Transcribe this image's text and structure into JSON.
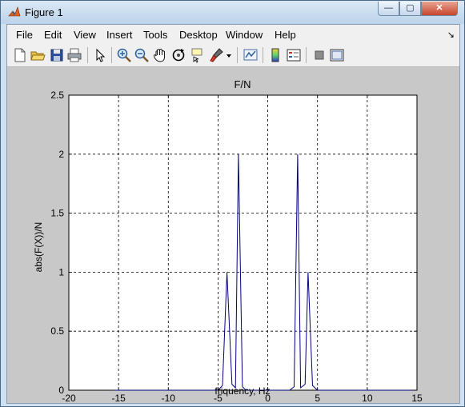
{
  "window": {
    "title": "Figure 1",
    "min_symbol": "—",
    "max_symbol": "▢",
    "close_symbol": "✕"
  },
  "menu": [
    "File",
    "Edit",
    "View",
    "Insert",
    "Tools",
    "Desktop",
    "Window",
    "Help"
  ],
  "toolbar_icons": [
    "new-figure-icon",
    "open-file-icon",
    "save-icon",
    "print-icon",
    "select-arrow-icon",
    "zoom-in-icon",
    "zoom-out-icon",
    "pan-hand-icon",
    "rotate-3d-icon",
    "data-cursor-icon",
    "brush-icon",
    "brush-dropdown-icon",
    "link-plot-icon",
    "colorbar-icon",
    "legend-icon",
    "hide-plot-tools-icon",
    "show-plot-tools-icon"
  ],
  "chart_data": {
    "type": "line",
    "title": "F/N",
    "xlabel": "friquency, Hz",
    "ylabel": "abs(F(X))/N",
    "xlim": [
      -20,
      15
    ],
    "ylim": [
      0,
      2.5
    ],
    "xticks": [
      -20,
      -15,
      -10,
      -5,
      0,
      5,
      10,
      15
    ],
    "yticks": [
      0,
      0.5,
      1,
      1.5,
      2,
      2.5
    ],
    "grid": true,
    "series": [
      {
        "color": "#00007f",
        "x": [
          -15.5,
          -5,
          -4.55,
          -4.1,
          -3.6,
          -3.25,
          -2.95,
          -2.55,
          -2.2,
          2.2,
          2.65,
          3.0,
          3.3,
          3.75,
          4.05,
          4.5,
          5,
          14.5
        ],
        "y": [
          0,
          0,
          0.04,
          1.0,
          0.05,
          0.02,
          2.0,
          0.03,
          0,
          0,
          0.03,
          2.0,
          0.02,
          0.05,
          1.0,
          0.04,
          0,
          0
        ]
      }
    ]
  }
}
